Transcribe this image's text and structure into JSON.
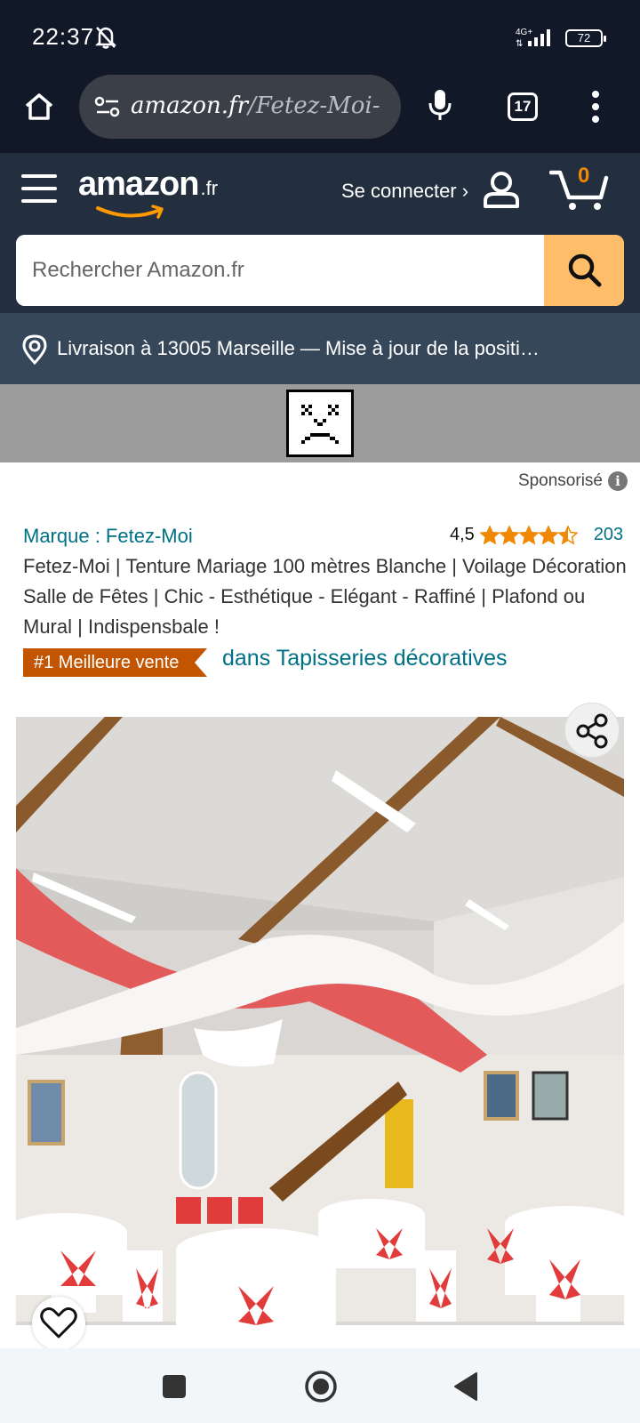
{
  "status_bar": {
    "time": "22:37",
    "network": "4G+",
    "battery": "72",
    "icons": [
      "bell-off-icon",
      "signal-icon",
      "battery-icon"
    ]
  },
  "browser": {
    "url_host": "amazon.fr",
    "url_path": "/Fetez-Moi-",
    "tab_count": "17",
    "icons": [
      "home-icon",
      "site-settings-icon",
      "mic-icon",
      "tabs-icon",
      "more-vert-icon"
    ]
  },
  "header": {
    "logo_text": "amazon",
    "logo_tld": ".fr",
    "signin_label": "Se connecter ›",
    "cart_count": "0",
    "icons": [
      "menu-icon",
      "user-icon",
      "cart-icon"
    ]
  },
  "search": {
    "placeholder": "Rechercher Amazon.fr",
    "icon": "search-icon"
  },
  "location": {
    "text": "Livraison à 13005 Marseille — Mise à jour de la positi…",
    "icon": "location-pin-icon"
  },
  "ad": {
    "icon": "broken-image-icon"
  },
  "sponsored": {
    "label": "Sponsorisé",
    "icon": "info-icon"
  },
  "product": {
    "brand": "Marque : Fetez-Moi",
    "rating": "4,5",
    "rating_value": 4.5,
    "rating_max": 5,
    "rating_count": "203",
    "title": "Fetez-Moi | Tenture Mariage 100 mètres Blanche | Voilage Décoration Salle de Fêtes | Chic - Esthétique - Elégant - Raffiné | Plafond ou Mural | Indispensbale !",
    "badge": "#1 Meilleure vente",
    "badge_category": "dans Tapisseries décoratives",
    "image_icon": "product-photo",
    "share_icon": "share-icon",
    "wishlist_icon": "heart-icon"
  },
  "colors": {
    "amazon_dark": "#232f3e",
    "amazon_nav": "#37475a",
    "amazon_orange": "#febd69",
    "link_teal": "#007185",
    "badge_orange": "#c45500",
    "star": "#f08804"
  },
  "nav": {
    "icons": [
      "recents-icon",
      "home-circle-icon",
      "back-icon"
    ]
  }
}
